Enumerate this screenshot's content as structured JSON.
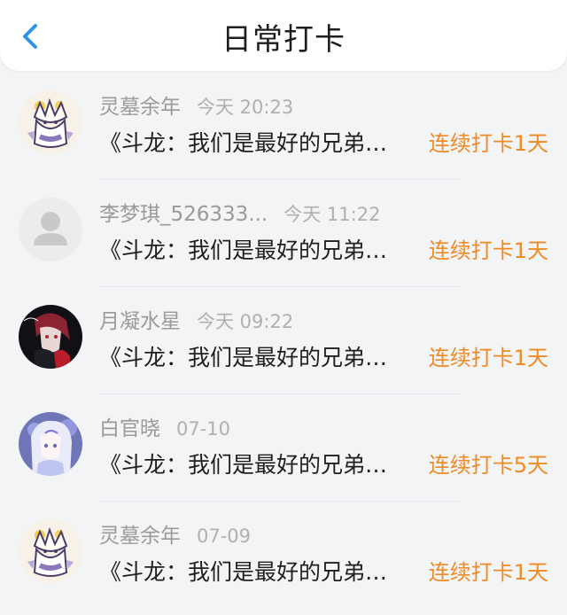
{
  "header": {
    "title": "日常打卡",
    "back_icon": "chevron-left-icon",
    "accent_color": "#2f95ea"
  },
  "items": [
    {
      "name": "灵墓余年",
      "time": "今天 20:23",
      "message": "《斗龙：我们是最好的兄弟…",
      "streak": "连续打卡1天",
      "avatar": "cartoon-fox-avatar"
    },
    {
      "name": "李梦琪_526333...",
      "time": "今天 11:22",
      "message": "《斗龙：我们是最好的兄弟…",
      "streak": "连续打卡1天",
      "avatar": "default-user-avatar"
    },
    {
      "name": "月凝水星",
      "time": "今天 09:22",
      "message": "《斗龙：我们是最好的兄弟…",
      "streak": "连续打卡1天",
      "avatar": "dark-anime-avatar"
    },
    {
      "name": "白官晓",
      "time": "07-10",
      "message": "《斗龙：我们是最好的兄弟…",
      "streak": "连续打卡5天",
      "avatar": "white-hair-anime-avatar"
    },
    {
      "name": "灵墓余年",
      "time": "07-09",
      "message": "《斗龙：我们是最好的兄弟…",
      "streak": "连续打卡1天",
      "avatar": "cartoon-fox-avatar"
    }
  ]
}
